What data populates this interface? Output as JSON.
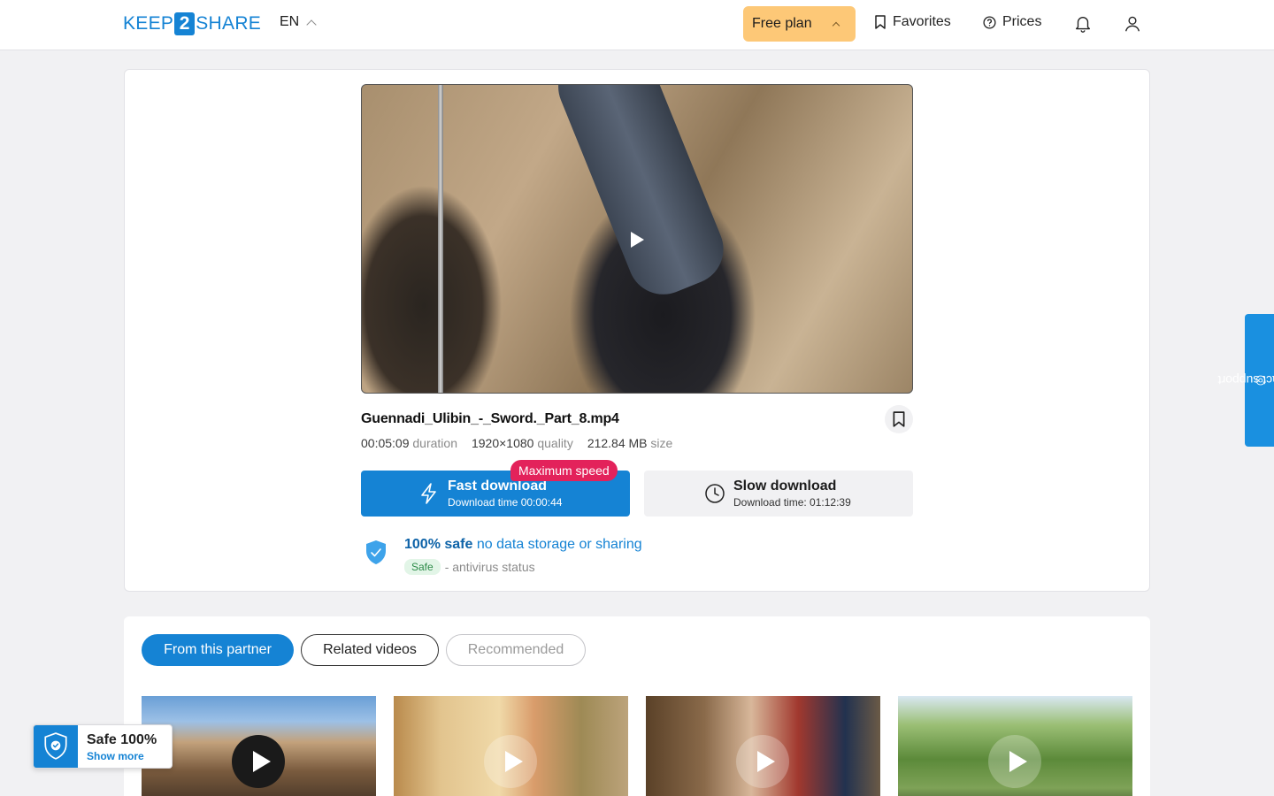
{
  "header": {
    "logo_left": "KEEP",
    "logo_mid": "2",
    "logo_right": "SHARE",
    "language": "EN",
    "plan_label": "Free plan",
    "favorites_label": "Favorites",
    "prices_label": "Prices"
  },
  "file": {
    "name": "Guennadi_Ulibin_-_Sword._Part_8.mp4",
    "duration_value": "00:05:09",
    "duration_label": "duration",
    "quality_value": "1920×1080",
    "quality_label": "quality",
    "size_value": "212.84 MB",
    "size_label": "size"
  },
  "download": {
    "badge": "Maximum speed",
    "fast_title": "Fast download",
    "fast_sub": "Download time 00:00:44",
    "slow_title": "Slow download",
    "slow_sub": "Download time: 01:12:39"
  },
  "safety": {
    "bold": "100% safe",
    "rest": "no data storage or sharing",
    "status_pill": "Safe",
    "status_text": "- antivirus status"
  },
  "related": {
    "tabs": [
      "From this partner",
      "Related videos",
      "Recommended"
    ]
  },
  "floating": {
    "support": "contact support",
    "safe_title": "Safe 100%",
    "safe_link": "Show more"
  },
  "colors": {
    "accent": "#1583d4",
    "plan": "#fdc877",
    "badge": "#e3225b"
  }
}
